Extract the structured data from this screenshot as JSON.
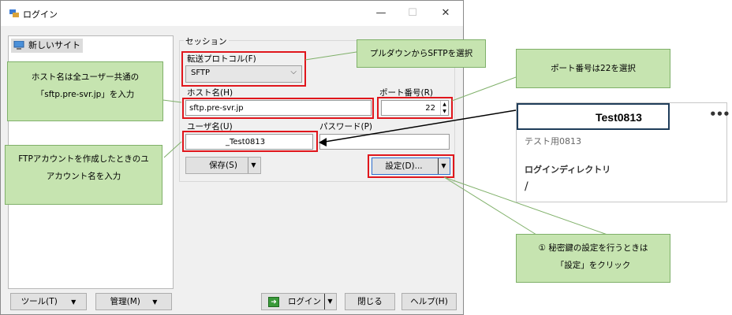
{
  "window": {
    "title": "ログイン",
    "minimize": "—",
    "maximize": "☐",
    "close": "✕"
  },
  "sites": {
    "new_site": "新しいサイト"
  },
  "session": {
    "group_label": "セッション",
    "protocol_label": "転送プロトコル(F)",
    "protocol_value": "SFTP",
    "host_label": "ホスト名(H)",
    "host_value": "sftp.pre-svr.jp",
    "port_label": "ポート番号(R)",
    "port_value": "22",
    "user_label": "ユーザ名(U)",
    "user_value": "_Test0813",
    "password_label": "パスワード(P)",
    "password_value": "",
    "save_label": "保存(S)",
    "settings_label": "設定(D)..."
  },
  "footer": {
    "tools": "ツール(T)",
    "manage": "管理(M)",
    "login": "ログイン",
    "close": "閉じる",
    "help": "ヘルプ(H)"
  },
  "callouts": {
    "protocol": "プルダウンからSFTPを選択",
    "port": "ポート番号は22を選択",
    "host_line1": "ホスト名は全ユーザー共通の",
    "host_line2": "「sftp.pre-svr.jp」を入力",
    "account_line1": "FTPアカウントを作成したときのユ",
    "account_line2": "アカウント名を入力",
    "secret_line1": "① 秘密鍵の設定を行うときは",
    "secret_line2": "「設定」をクリック"
  },
  "card": {
    "username": "Test0813",
    "more": "•••",
    "description": "テスト用0813",
    "dir_label": "ログインディレクトリ",
    "dir_value": "/"
  },
  "colors": {
    "highlight": "#e0161c",
    "callout_bg": "#c6e4b0",
    "accent": "#2f6fd0"
  }
}
